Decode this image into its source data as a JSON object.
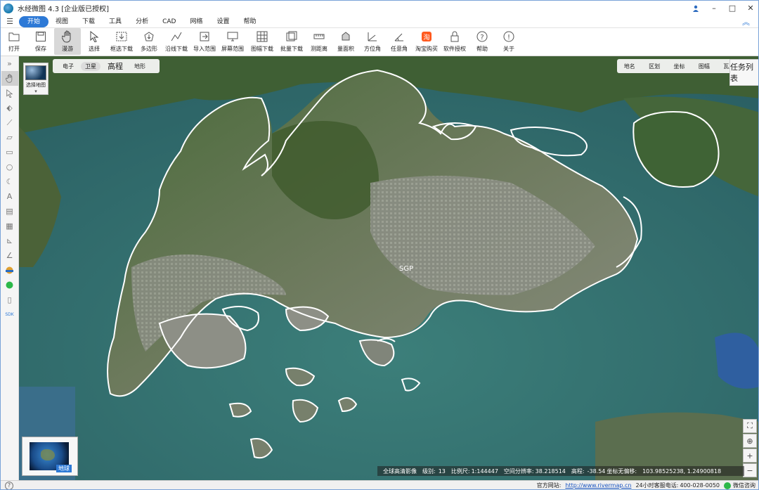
{
  "app": {
    "title": "水经微图 4.3 [企业版已授权]"
  },
  "menu": {
    "items": [
      {
        "label": "开始",
        "active": true
      },
      {
        "label": "视图"
      },
      {
        "label": "下载"
      },
      {
        "label": "工具"
      },
      {
        "label": "分析"
      },
      {
        "label": "CAD"
      },
      {
        "label": "网络"
      },
      {
        "label": "设置"
      },
      {
        "label": "帮助"
      }
    ]
  },
  "ribbon": {
    "open": "打开",
    "save": "保存",
    "pan": "漫游",
    "select": "选择",
    "frame_download": "框选下载",
    "polygon": "多边形",
    "line_download": "沿线下载",
    "import_range": "导入范围",
    "screen_range": "屏幕范围",
    "sheet_download": "图幅下载",
    "batch_download": "批量下载",
    "measure_distance": "测距离",
    "measure_area": "量面积",
    "azimuth": "方位角",
    "any_angle": "任意角",
    "taobao": "淘宝购买",
    "license": "软件授权",
    "help": "帮助",
    "about": "关于"
  },
  "map": {
    "layer_switch_label": "选择地图",
    "tabs": [
      {
        "label": "电子"
      },
      {
        "label": "卫星",
        "active": true
      },
      {
        "label": "高程"
      },
      {
        "label": "地形"
      }
    ],
    "right_tools": [
      "地名",
      "区划",
      "坐标",
      "图幅",
      "瓦片"
    ],
    "task_list": "任务列表",
    "place_label": "SGP",
    "earth_label": "地球"
  },
  "status": {
    "imagery": "全球高清影像",
    "level_label": "级别:",
    "level": "13",
    "scale_label": "比例尺:",
    "scale": "1:144447",
    "resolution_label": "空间分辨率:",
    "resolution": "38.218514",
    "elevation_label": "高程:",
    "elevation": "-38.54",
    "offset_label": "坐标无偏移:",
    "coords": "103.98525238, 1.24900818"
  },
  "footer": {
    "website_label": "官方网站:",
    "website": "http://www.rivermap.cn",
    "phone_label": "24小时客服电话:",
    "phone": "400-028-0050",
    "wechat": "微信咨询"
  }
}
